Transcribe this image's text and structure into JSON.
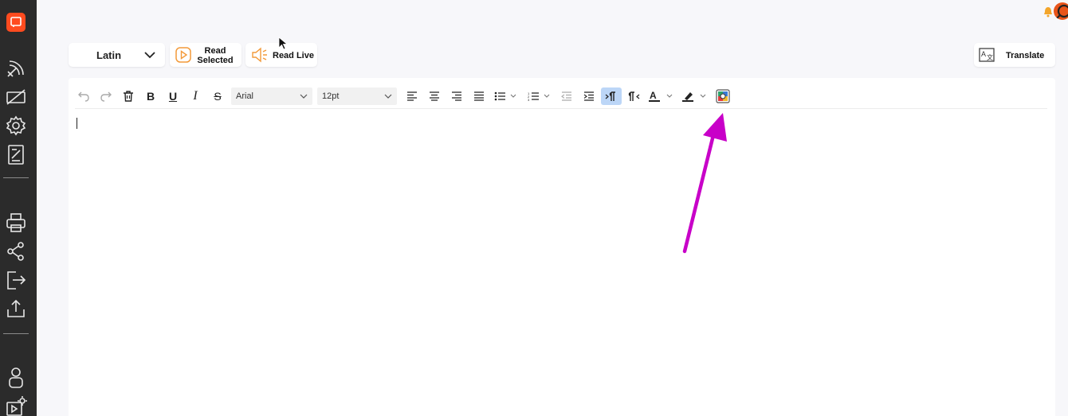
{
  "sidebar": {
    "items": [
      {
        "icon": "logo-icon"
      },
      {
        "icon": "satellite-icon"
      },
      {
        "icon": "no-display-icon"
      },
      {
        "icon": "gear-icon"
      },
      {
        "icon": "document-edit-icon"
      },
      {
        "icon": "printer-icon"
      },
      {
        "icon": "share-icon"
      },
      {
        "icon": "export-icon"
      },
      {
        "icon": "upload-icon"
      },
      {
        "icon": "user-icon"
      },
      {
        "icon": "video-settings-icon"
      }
    ]
  },
  "controls": {
    "language": "Latin",
    "read_selected": "Read Selected",
    "read_selected_line1": "Read",
    "read_selected_line2": "Selected",
    "read_live": "Read Live",
    "translate": "Translate"
  },
  "toolbar": {
    "font_family": "Arial",
    "font_size": "12pt",
    "bold": "B",
    "underline": "U",
    "italic": "I",
    "strike": "S"
  },
  "colors": {
    "accent": "#f39a3a",
    "sidebar_bg": "#2b2b2b",
    "logo": "#ff4b1f",
    "annotation_arrow": "#c800c8",
    "active_button": "#bcd6f7"
  }
}
